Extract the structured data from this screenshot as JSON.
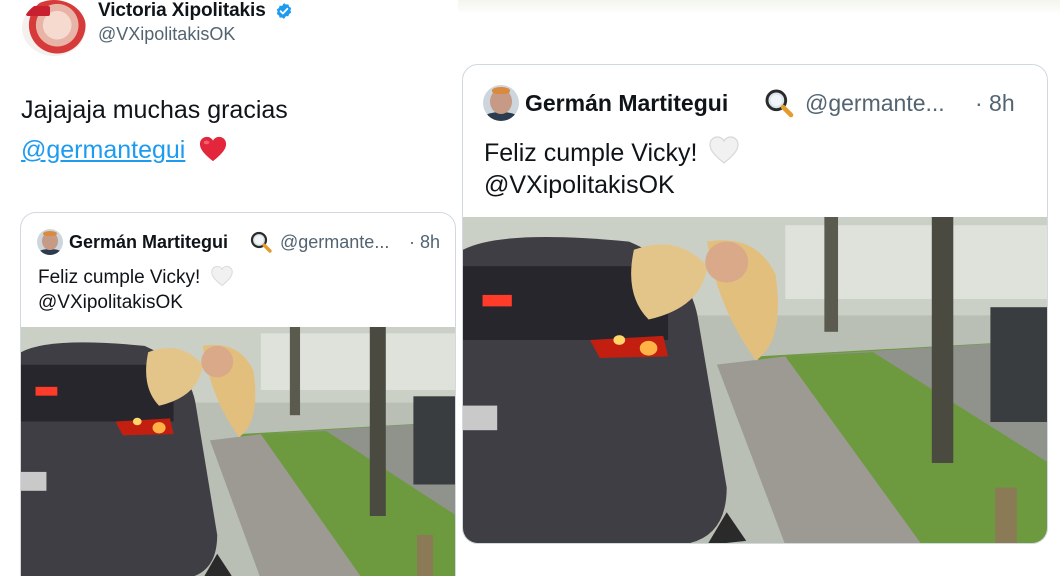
{
  "reply": {
    "author_name": "Victoria Xipolitakis",
    "author_handle": "@VXipolitakisOK",
    "text_line1": "Jajajaja muchas gracias",
    "mention": "@germantegui"
  },
  "quoted": {
    "author_name": "Germán Martitegui",
    "author_handle_truncated": "@germante...",
    "time": "· 8h",
    "text_line1": "Feliz cumple Vicky!",
    "text_line2": "@VXipolitakisOK"
  },
  "icons": {
    "verified": "verified-badge-icon",
    "heart": "red-heart-emoji",
    "white_heart": "white-heart-emoji",
    "magnifier": "magnifying-glass-emoji"
  },
  "colors": {
    "verified": "#1d9bf0",
    "mention": "#1d9bf0",
    "heart": "#e0245e",
    "secondary_text": "#536471",
    "border": "#cfd9de"
  }
}
